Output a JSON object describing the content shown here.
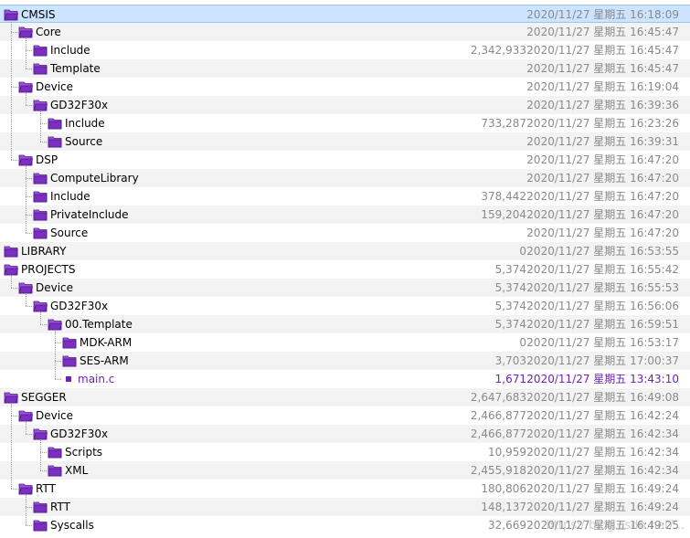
{
  "tree": {
    "rows": [
      {
        "name": "CMSIS",
        "size": "",
        "date": "2020/11/27 星期五 16:18:09",
        "depth": 0,
        "type": "folder",
        "selected": true
      },
      {
        "name": "Core",
        "size": "",
        "date": "2020/11/27 星期五 16:45:47",
        "depth": 1,
        "type": "folder"
      },
      {
        "name": "Include",
        "size": "2,342,933",
        "date": "2020/11/27 星期五 16:45:47",
        "depth": 2,
        "type": "folder"
      },
      {
        "name": "Template",
        "size": "",
        "date": "2020/11/27 星期五 16:45:47",
        "depth": 2,
        "type": "folder"
      },
      {
        "name": "Device",
        "size": "",
        "date": "2020/11/27 星期五 16:19:04",
        "depth": 1,
        "type": "folder"
      },
      {
        "name": "GD32F30x",
        "size": "",
        "date": "2020/11/27 星期五 16:39:36",
        "depth": 2,
        "type": "folder"
      },
      {
        "name": "Include",
        "size": "733,287",
        "date": "2020/11/27 星期五 16:23:26",
        "depth": 3,
        "type": "folder"
      },
      {
        "name": "Source",
        "size": "",
        "date": "2020/11/27 星期五 16:39:31",
        "depth": 3,
        "type": "folder"
      },
      {
        "name": "DSP",
        "size": "",
        "date": "2020/11/27 星期五 16:47:20",
        "depth": 1,
        "type": "folder"
      },
      {
        "name": "ComputeLibrary",
        "size": "",
        "date": "2020/11/27 星期五 16:47:20",
        "depth": 2,
        "type": "folder"
      },
      {
        "name": "Include",
        "size": "378,442",
        "date": "2020/11/27 星期五 16:47:20",
        "depth": 2,
        "type": "folder"
      },
      {
        "name": "PrivateInclude",
        "size": "159,204",
        "date": "2020/11/27 星期五 16:47:20",
        "depth": 2,
        "type": "folder"
      },
      {
        "name": "Source",
        "size": "",
        "date": "2020/11/27 星期五 16:47:20",
        "depth": 2,
        "type": "folder"
      },
      {
        "name": "LIBRARY",
        "size": "0",
        "date": "2020/11/27 星期五 16:53:55",
        "depth": 0,
        "type": "folder"
      },
      {
        "name": "PROJECTS",
        "size": "5,374",
        "date": "2020/11/27 星期五 16:55:42",
        "depth": 0,
        "type": "folder"
      },
      {
        "name": "Device",
        "size": "5,374",
        "date": "2020/11/27 星期五 16:55:53",
        "depth": 1,
        "type": "folder"
      },
      {
        "name": "GD32F30x",
        "size": "5,374",
        "date": "2020/11/27 星期五 16:56:06",
        "depth": 2,
        "type": "folder"
      },
      {
        "name": "00.Template",
        "size": "5,374",
        "date": "2020/11/27 星期五 16:59:51",
        "depth": 3,
        "type": "folder"
      },
      {
        "name": "MDK-ARM",
        "size": "0",
        "date": "2020/11/27 星期五 16:53:17",
        "depth": 4,
        "type": "folder"
      },
      {
        "name": "SES-ARM",
        "size": "3,703",
        "date": "2020/11/27 星期五 17:00:37",
        "depth": 4,
        "type": "folder"
      },
      {
        "name": "main.c",
        "size": "1,671",
        "date": "2020/11/27 星期五 13:43:10",
        "depth": 4,
        "type": "file"
      },
      {
        "name": "SEGGER",
        "size": "2,647,683",
        "date": "2020/11/27 星期五 16:49:08",
        "depth": 0,
        "type": "folder"
      },
      {
        "name": "Device",
        "size": "2,466,877",
        "date": "2020/11/27 星期五 16:42:24",
        "depth": 1,
        "type": "folder"
      },
      {
        "name": "GD32F30x",
        "size": "2,466,877",
        "date": "2020/11/27 星期五 16:42:34",
        "depth": 2,
        "type": "folder"
      },
      {
        "name": "Scripts",
        "size": "10,959",
        "date": "2020/11/27 星期五 16:42:34",
        "depth": 3,
        "type": "folder"
      },
      {
        "name": "XML",
        "size": "2,455,918",
        "date": "2020/11/27 星期五 16:42:34",
        "depth": 3,
        "type": "folder"
      },
      {
        "name": "RTT",
        "size": "180,806",
        "date": "2020/11/27 星期五 16:49:24",
        "depth": 1,
        "type": "folder"
      },
      {
        "name": "RTT",
        "size": "148,137",
        "date": "2020/11/27 星期五 16:49:24",
        "depth": 2,
        "type": "folder"
      },
      {
        "name": "Syscalls",
        "size": "32,669",
        "date": "2020/11/27 星期五 16:49:25",
        "depth": 2,
        "type": "folder"
      }
    ]
  },
  "watermark": "https://blog.csdn.net/...",
  "colors": {
    "folder_fill": "#7a2fc0",
    "folder_tab": "#9b4fe0",
    "file_text": "#7020b8",
    "selected_bg": "#cce4ff",
    "alt_row": "#f3f3f3"
  },
  "icons": {
    "folder_open": "folder-open-icon",
    "folder_closed": "folder-icon",
    "file": "file-icon"
  }
}
